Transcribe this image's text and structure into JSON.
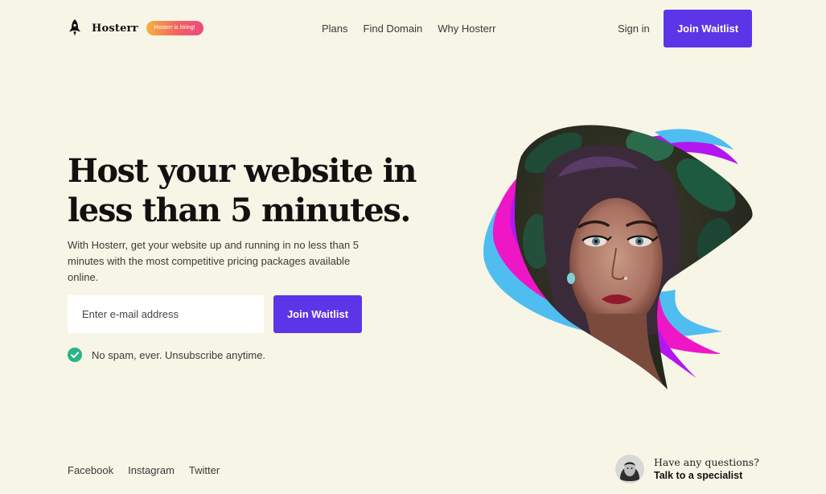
{
  "brand": {
    "name": "Hosterr",
    "badge": "Hosterr is hiring!",
    "logo_icon": "rocket-icon"
  },
  "nav": {
    "items": [
      {
        "label": "Plans"
      },
      {
        "label": "Find Domain"
      },
      {
        "label": "Why Hosterr"
      }
    ],
    "sign_in": "Sign in",
    "cta": "Join Waitlist"
  },
  "hero": {
    "title": "Host your website in less than 5 minutes.",
    "description": "With Hosterr, get your website up and running in no less than 5 minutes with the most competitive pricing packages available online.",
    "email_placeholder": "Enter e-mail address",
    "cta": "Join Waitlist",
    "note": "No spam, ever. Unsubscribe anytime.",
    "note_icon": "check-circle-icon"
  },
  "footer": {
    "social": [
      {
        "label": "Facebook"
      },
      {
        "label": "Instagram"
      },
      {
        "label": "Twitter"
      }
    ],
    "support_question": "Have any questions?",
    "support_link": "Talk to a specialist"
  },
  "colors": {
    "background": "#f7f5e6",
    "accent": "#5c35e8",
    "check": "#2bb389",
    "shape_blue": "#4fbdf0",
    "shape_magenta": "#ee16c6",
    "shape_purple": "#b317f0"
  }
}
